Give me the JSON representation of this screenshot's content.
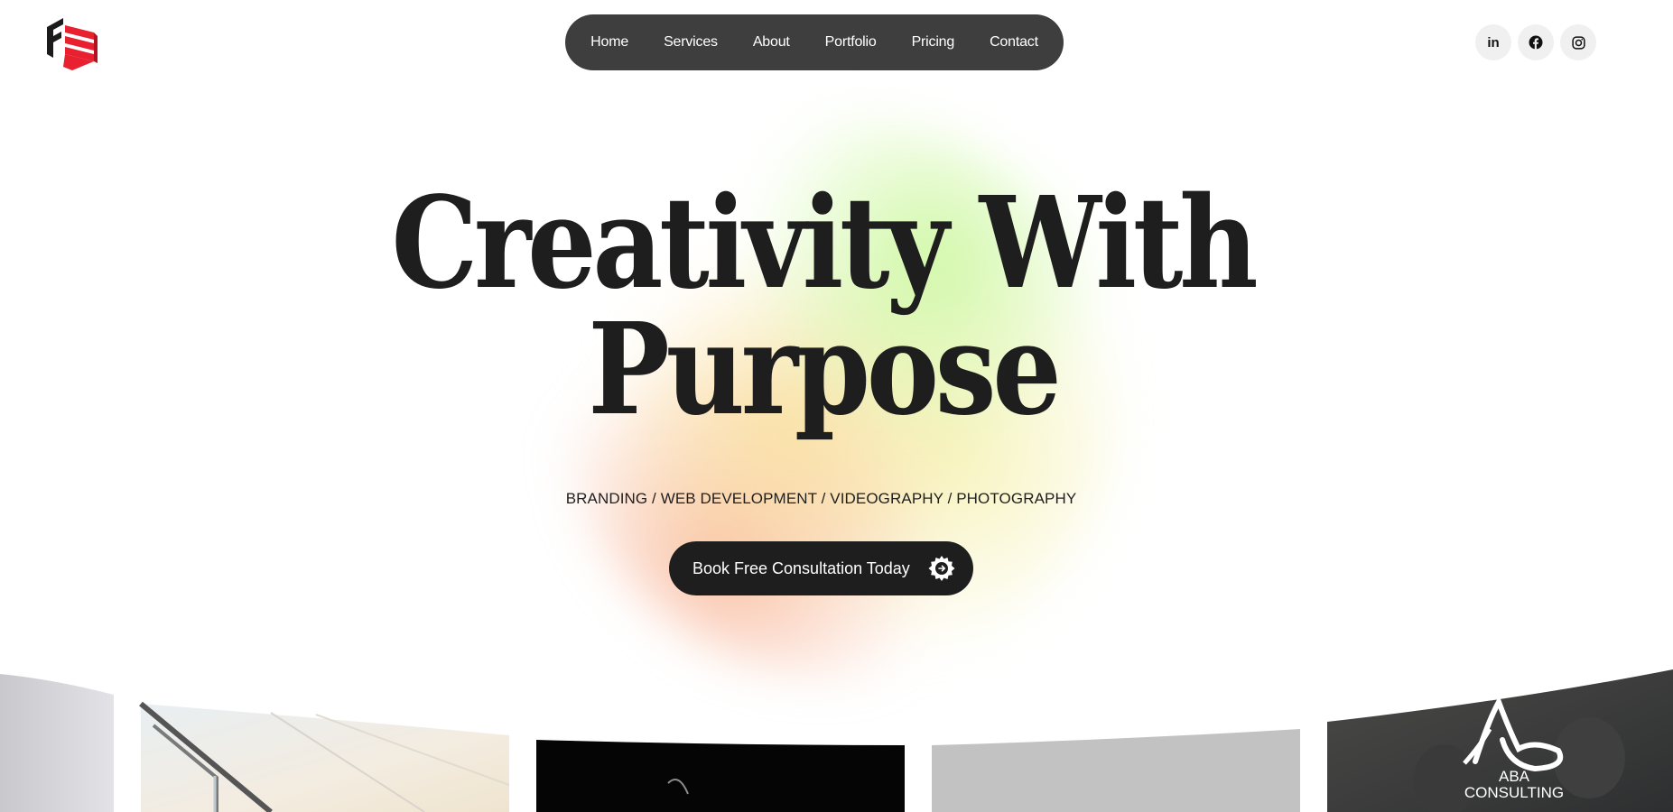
{
  "header": {
    "logo_icon": "brand-logo-icon",
    "nav": [
      {
        "label": "Home"
      },
      {
        "label": "Services"
      },
      {
        "label": "About"
      },
      {
        "label": "Portfolio"
      },
      {
        "label": "Pricing"
      },
      {
        "label": "Contact"
      }
    ],
    "social": [
      {
        "icon": "linkedin-icon",
        "glyph": "in"
      },
      {
        "icon": "facebook-icon"
      },
      {
        "icon": "instagram-icon"
      }
    ]
  },
  "hero": {
    "headline_line1": "Creativity With",
    "headline_line2": "Purpose",
    "tagline": "BRANDING / WEB DEVELOPMENT / VIDEOGRAPHY / PHOTOGRAPHY",
    "cta_label": "Book Free Consultation Today",
    "cta_icon": "arrow-right-badge-icon"
  },
  "gallery": {
    "cards": [
      {
        "name": "card-left-partial"
      },
      {
        "name": "card-office-window"
      },
      {
        "name": "card-dark"
      },
      {
        "name": "card-gray"
      },
      {
        "name": "card-aba-consulting",
        "logo_text_1": "ABA",
        "logo_text_2": "CONSULTING"
      }
    ]
  },
  "colors": {
    "nav_bg": "#3e3e3e",
    "cta_bg": "#1e1e1e",
    "logo_red": "#e8202f",
    "logo_dark": "#1b1b1b"
  }
}
